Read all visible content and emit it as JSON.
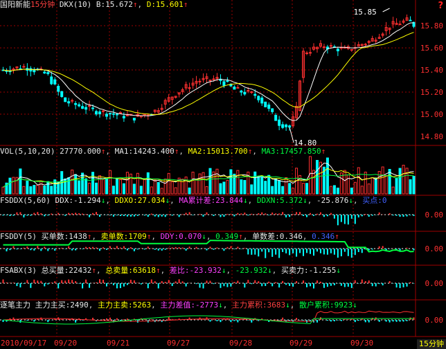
{
  "title": {
    "name": "国阳新能",
    "period": "15分钟",
    "indicator": "DKX(10)",
    "b_label": "B:",
    "b_value": "15.672",
    "d_label": "D:",
    "d_value": "15.601"
  },
  "help_icon": "?",
  "price_axis": [
    "15.80",
    "15.60",
    "15.40",
    "15.20",
    "15.00",
    "14.80"
  ],
  "price_range": [
    14.73,
    15.92
  ],
  "annotations": {
    "high": "15.85",
    "low": "14.80"
  },
  "vol": {
    "label": "VOL(5,10,20)",
    "value": "27770.000",
    "ma1_label": "MA1:",
    "ma1": "14243.400",
    "ma2_label": "MA2:",
    "ma2": "15013.700",
    "ma3_label": "MA3:",
    "ma3": "17457.850"
  },
  "fsddx": {
    "label": "FSDDX(5,60)",
    "ddx_label": "DDX:",
    "ddx": "-1.294",
    "ddxo_label": "DDXO:",
    "ddxo": "27.034",
    "ma_label": "MA累计差:",
    "ma": "23.844",
    "ddxn_label": "DDXN:",
    "ddxn": "5.372",
    "v5": "-25.876",
    "v6_label": "买点:",
    "v6": "0",
    "axis": "0.00"
  },
  "fsddy": {
    "label": "FSDDY(5)",
    "buy_label": "买单数:",
    "buy": "1438",
    "sell_label": "卖单数:",
    "sell": "1709",
    "ddy_label": "DDY:",
    "ddy": "0.070",
    "v4": "0.349",
    "diff_label": "单数差:",
    "diff": "0.346",
    "v6": "0.346",
    "axis": "0.00"
  },
  "fsabx": {
    "label": "FSABX(3)",
    "buy_label": "总买量:",
    "buy": "22432",
    "sell_label": "总卖量:",
    "sell": "63618",
    "ratio_label": "差比:",
    "ratio": "-23.932",
    "v4": "-23.932",
    "force_label": "买卖力:",
    "force": "-1.255",
    "axis": "0.00"
  },
  "main": {
    "label": "逐笔主力",
    "buy_label": "主力主买:",
    "buy": "2490",
    "sell_label": "主力主卖:",
    "sell": "5263",
    "diff_label": "主力差值:",
    "diff": "-2773",
    "acc_label": "主力累积:",
    "acc": "3683",
    "retail_label": "散户累积:",
    "retail": "9923",
    "axis": "0.00"
  },
  "dates": [
    "2010/09/17",
    "09/20",
    "09/21",
    "09/27",
    "09/28",
    "09/29",
    "09/30"
  ],
  "timeframe": "15分钟",
  "colors": {
    "up": "#ff3030",
    "down": "#00ffff",
    "grid": "#a00000",
    "ma_white": "#ffffff",
    "ma_yellow": "#ffff00"
  }
}
